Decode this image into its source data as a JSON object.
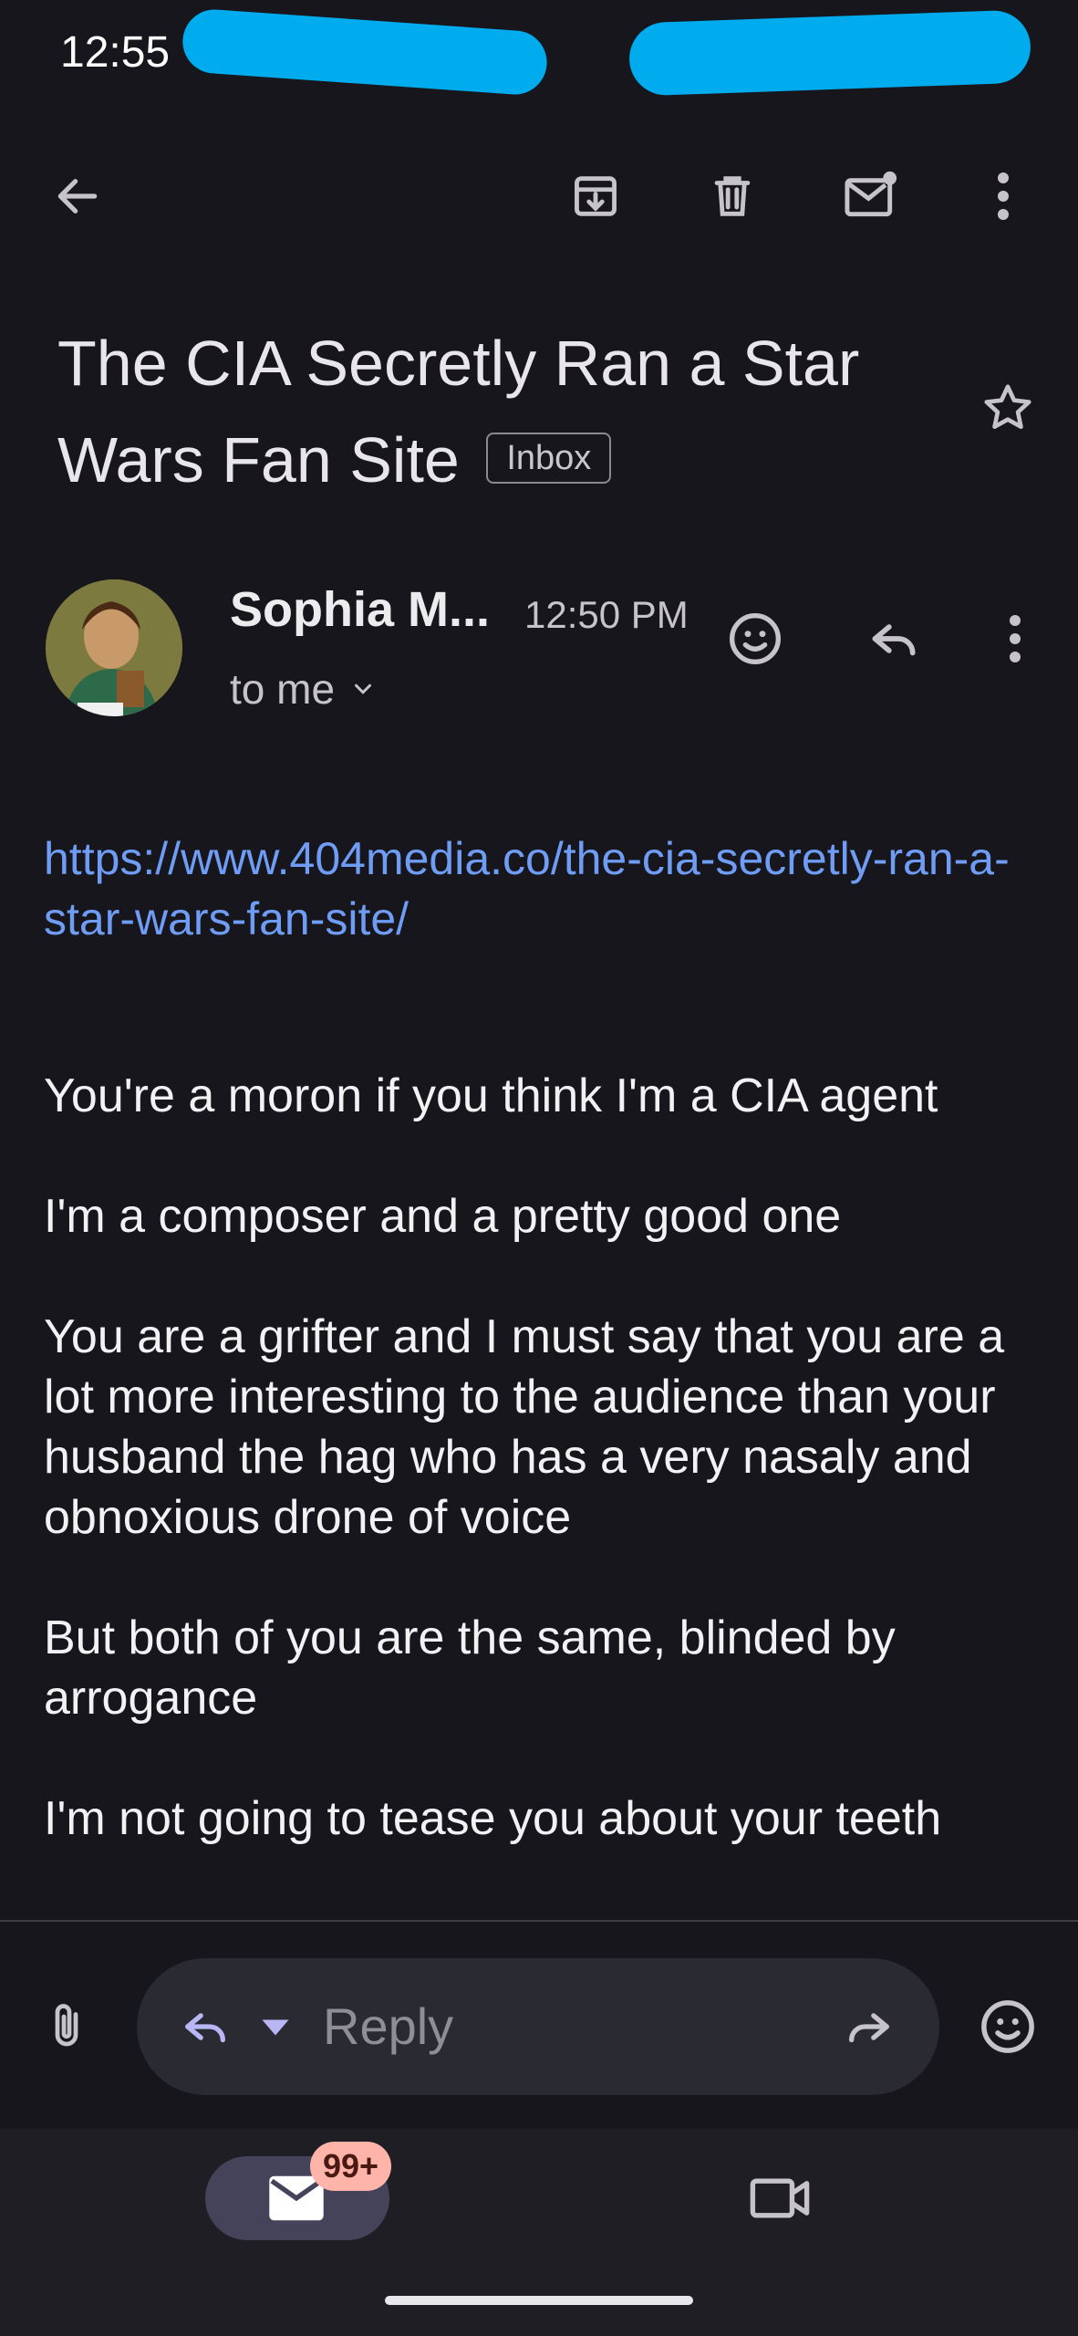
{
  "status_bar": {
    "time": "12:55"
  },
  "toolbar": {
    "back_icon": "arrow-left-icon",
    "archive_icon": "archive-icon",
    "delete_icon": "trash-icon",
    "mark_unread_icon": "mail-unread-icon",
    "more_icon": "more-vert-icon"
  },
  "email": {
    "subject": "The CIA Secretly Ran a Star Wars Fan Site",
    "label": "Inbox",
    "sender": "Sophia M...",
    "time": "12:50 PM",
    "recipient": "to me",
    "link": "https://www.404media.co/the-cia-secretly-ran-a-star-wars-fan-site/",
    "paragraphs": [
      "You're a moron if you think I'm a CIA agent",
      "I'm a composer and a pretty good one",
      "You are a grifter and I must say that you are a lot more interesting to the audience than your husband the hag who has a very nasaly and obnoxious drone of voice",
      "But both of you are the same, blinded by arrogance",
      "I'm not going to tease you about your teeth"
    ]
  },
  "reply_bar": {
    "placeholder": "Reply"
  },
  "bottom_nav": {
    "mail_badge": "99+"
  },
  "colors": {
    "background": "#16161c",
    "link": "#6f9cf5",
    "accent_pill": "#44435a",
    "badge": "#ffb4a9"
  }
}
